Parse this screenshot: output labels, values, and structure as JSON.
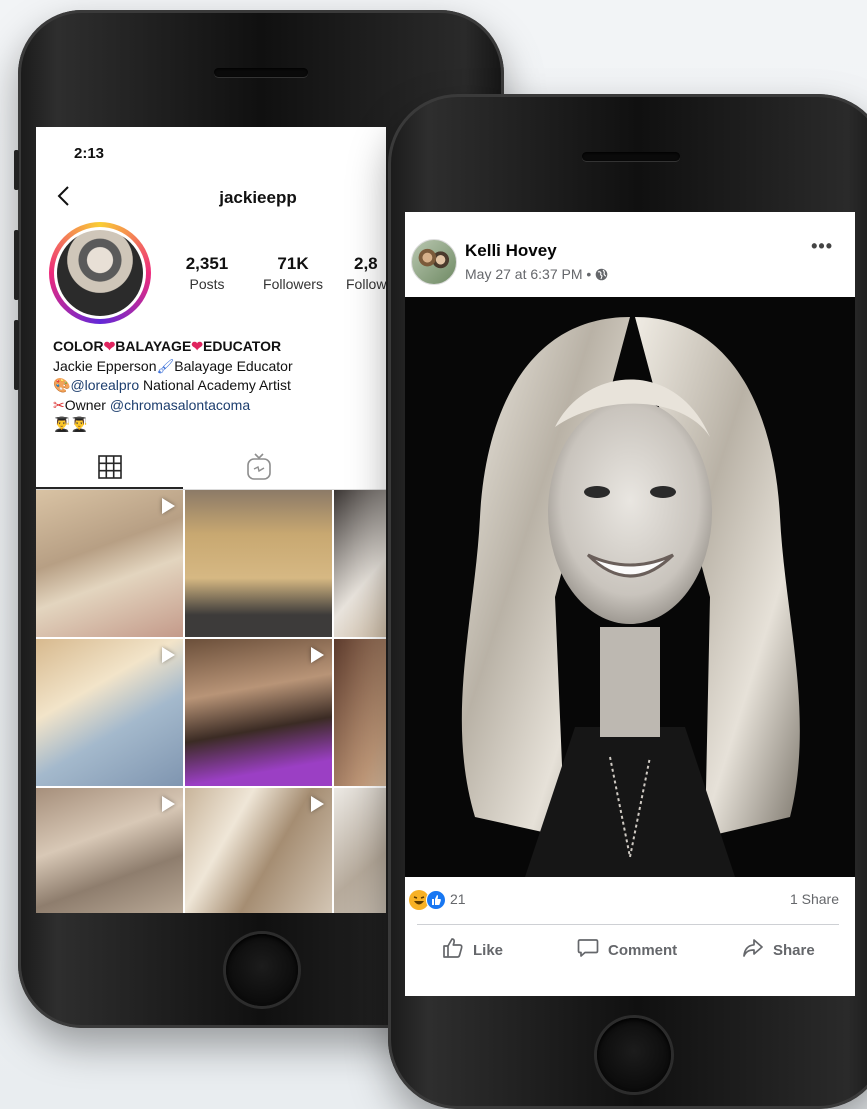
{
  "instagram": {
    "status_time": "2:13",
    "username": "jackieepp",
    "stats": [
      {
        "value": "2,351",
        "label": "Posts"
      },
      {
        "value": "71K",
        "label": "Followers"
      },
      {
        "value": "2,8",
        "label": "Follow"
      }
    ],
    "bio": {
      "title_part1": "COLOR",
      "title_part2": "BALAYAGE",
      "title_part3": "EDUCATOR",
      "line2": "Jackie Epperson",
      "line2b": "Balayage Educator",
      "line3_link": "@lorealpro",
      "line3_rest": " National Academy Artist",
      "line4_prefix": "Owner ",
      "line4_link": "@chromasalontacoma"
    },
    "post_count_visible": 9
  },
  "facebook": {
    "author": "Kelli Hovey",
    "timestamp": "May 27 at 6:37 PM",
    "audience_separator": " • ",
    "reactions_count": "21",
    "shares": "1 Share",
    "actions": {
      "like": "Like",
      "comment": "Comment",
      "share": "Share"
    }
  },
  "colors": {
    "ig_link": "#1d3e6e",
    "fb_gray": "#65676b",
    "heart": "#e0245e"
  }
}
